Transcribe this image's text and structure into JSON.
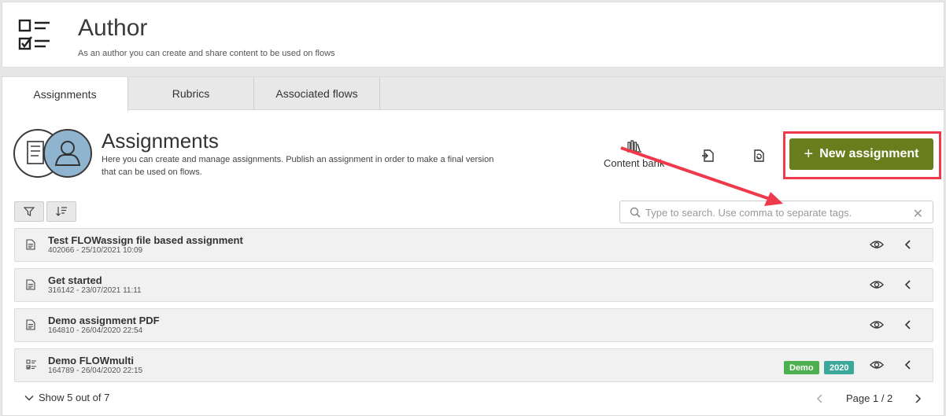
{
  "header": {
    "title": "Author",
    "subtitle": "As an author you can create and share content to be used on flows",
    "logo_icon": "checklist-icon"
  },
  "tabs": [
    {
      "label": "Assignments",
      "active": true
    },
    {
      "label": "Rubrics",
      "active": false
    },
    {
      "label": "Associated flows",
      "active": false
    }
  ],
  "section": {
    "title": "Assignments",
    "description": "Here you can create and manage assignments. Publish an assignment in order to make a final version that can be used on flows."
  },
  "toolbar": {
    "content_bank_label": "Content bank",
    "content_bank_icon": "library-icon",
    "import_icon": "import-icon",
    "sync_icon": "sync-icon",
    "new_assignment_label": "New assignment"
  },
  "search": {
    "placeholder": "Type to search. Use comma to separate tags.",
    "value": ""
  },
  "rows": [
    {
      "title": "Test FLOWassign file based assignment",
      "meta": "402066 - 25/10/2021 10:09",
      "icon": "document-icon",
      "tags": []
    },
    {
      "title": "Get started",
      "meta": "316142 - 23/07/2021 11:11",
      "icon": "document-icon",
      "tags": []
    },
    {
      "title": "Demo assignment PDF",
      "meta": "164810 - 26/04/2020 22:54",
      "icon": "document-icon",
      "tags": []
    },
    {
      "title": "Demo FLOWmulti",
      "meta": "164789 - 26/04/2020 22:15",
      "icon": "checklist-icon",
      "tags": [
        {
          "label": "Demo",
          "color": "#4caf50"
        },
        {
          "label": "2020",
          "color": "#3aa89a"
        }
      ]
    }
  ],
  "footer": {
    "show_more": "Show 5 out of 7",
    "page": "Page 1 / 2"
  },
  "colors": {
    "primary_button": "#6a7d1c",
    "annotation": "#ee3a4a"
  }
}
